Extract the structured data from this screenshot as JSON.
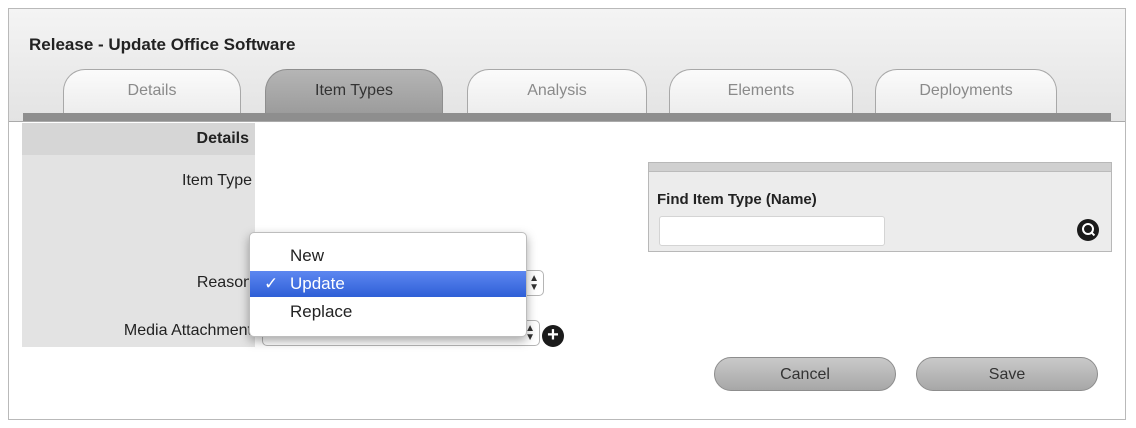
{
  "window": {
    "title": "Release - Update Office Software"
  },
  "tabs": [
    {
      "label": "Details",
      "active": false
    },
    {
      "label": "Item Types",
      "active": true
    },
    {
      "label": "Analysis",
      "active": false
    },
    {
      "label": "Elements",
      "active": false
    },
    {
      "label": "Deployments",
      "active": false
    }
  ],
  "form": {
    "section_header": "Details",
    "item_type_label": "Item Type",
    "reason_label": "Reason",
    "media_label": "Media Attachment"
  },
  "reason_menu": {
    "selected": "Update",
    "options": [
      "New",
      "Update",
      "Replace"
    ]
  },
  "find_panel": {
    "label": "Find Item Type (Name)",
    "value": ""
  },
  "buttons": {
    "cancel": "Cancel",
    "save": "Save"
  },
  "icons": {
    "search": "search-icon",
    "add": "plus-icon",
    "check": "checkmark-icon"
  },
  "colors": {
    "selection": "#3565dd",
    "active_tab": "#a8a8a8"
  }
}
